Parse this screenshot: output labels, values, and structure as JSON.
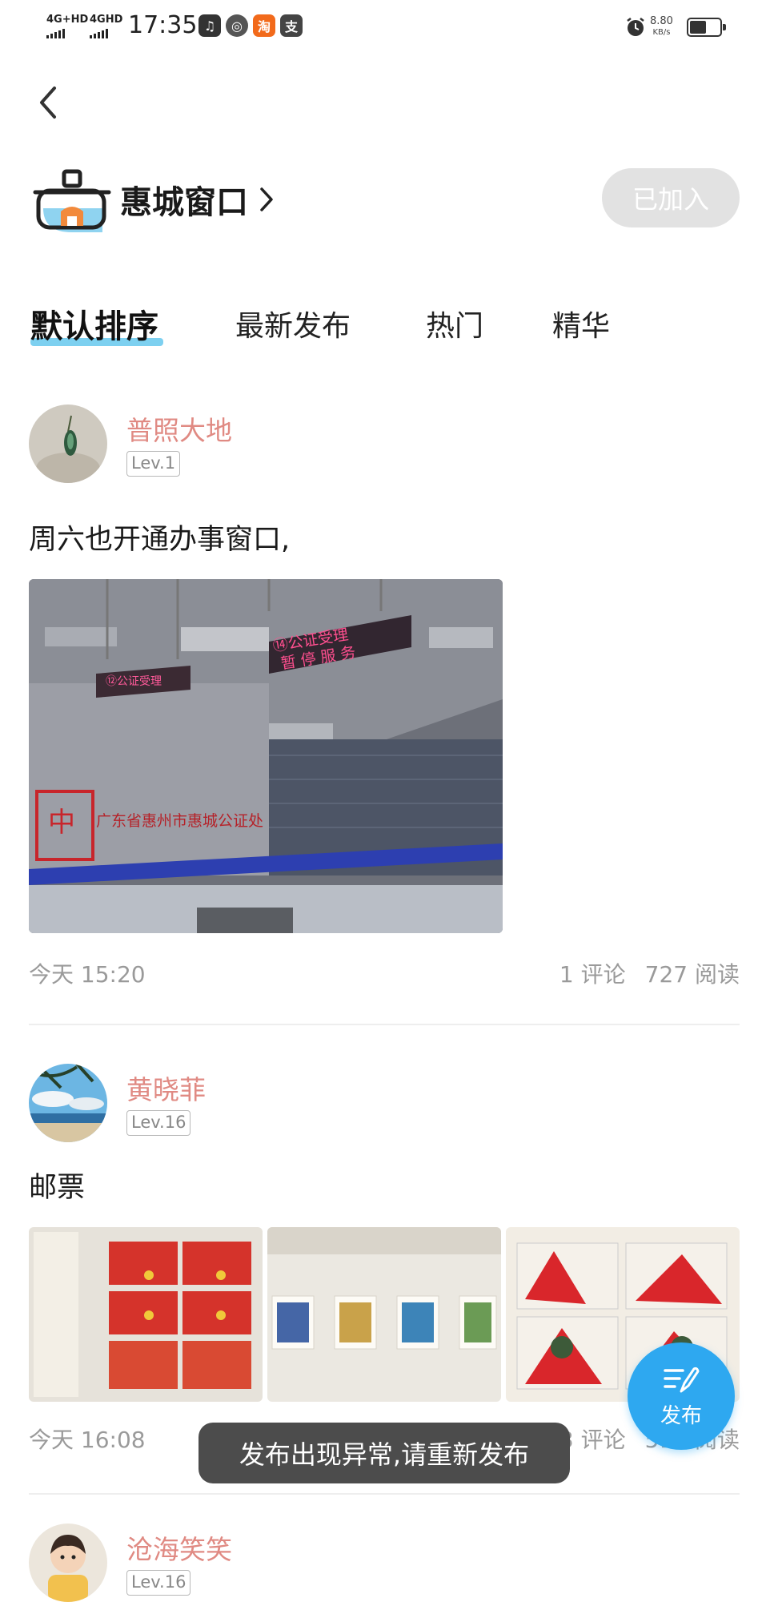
{
  "status_bar": {
    "network1": "4G+HD",
    "network2": "4GHD",
    "time": "17:35",
    "speed_value": "8.80",
    "speed_unit": "KB/s",
    "app_icons": [
      "music-app-icon",
      "compass-app-icon",
      "taobao-app-icon",
      "alipay-app-icon"
    ],
    "battery_level": 0.55
  },
  "header": {
    "group_name": "惠城窗口",
    "join_label": "已加入"
  },
  "tabs": [
    {
      "label": "默认排序",
      "active": true
    },
    {
      "label": "最新发布",
      "active": false
    },
    {
      "label": "热门",
      "active": false
    },
    {
      "label": "精华",
      "active": false
    }
  ],
  "posts": [
    {
      "author": "普照大地",
      "level": "Lev.1",
      "text": "周六也开通办事窗口,",
      "time": "今天 15:20",
      "comments": "1 评论",
      "reads": "727 阅读",
      "image_sign": "⑭公证受理\n暂 停 服 务"
    },
    {
      "author": "黄晓菲",
      "level": "Lev.16",
      "text": "邮票",
      "time": "今天 16:08",
      "comments": "3 评论",
      "reads": "513 阅读"
    },
    {
      "author": "沧海笑笑",
      "level": "Lev.16"
    }
  ],
  "fab": {
    "label": "发布"
  },
  "toast": {
    "message": "发布出现异常,请重新发布"
  },
  "colors": {
    "accent_blue": "#2ea8f0",
    "tab_underline": "#5cc4ec",
    "author_name": "#e08a83",
    "joined_button_bg": "#e2e2e2"
  }
}
